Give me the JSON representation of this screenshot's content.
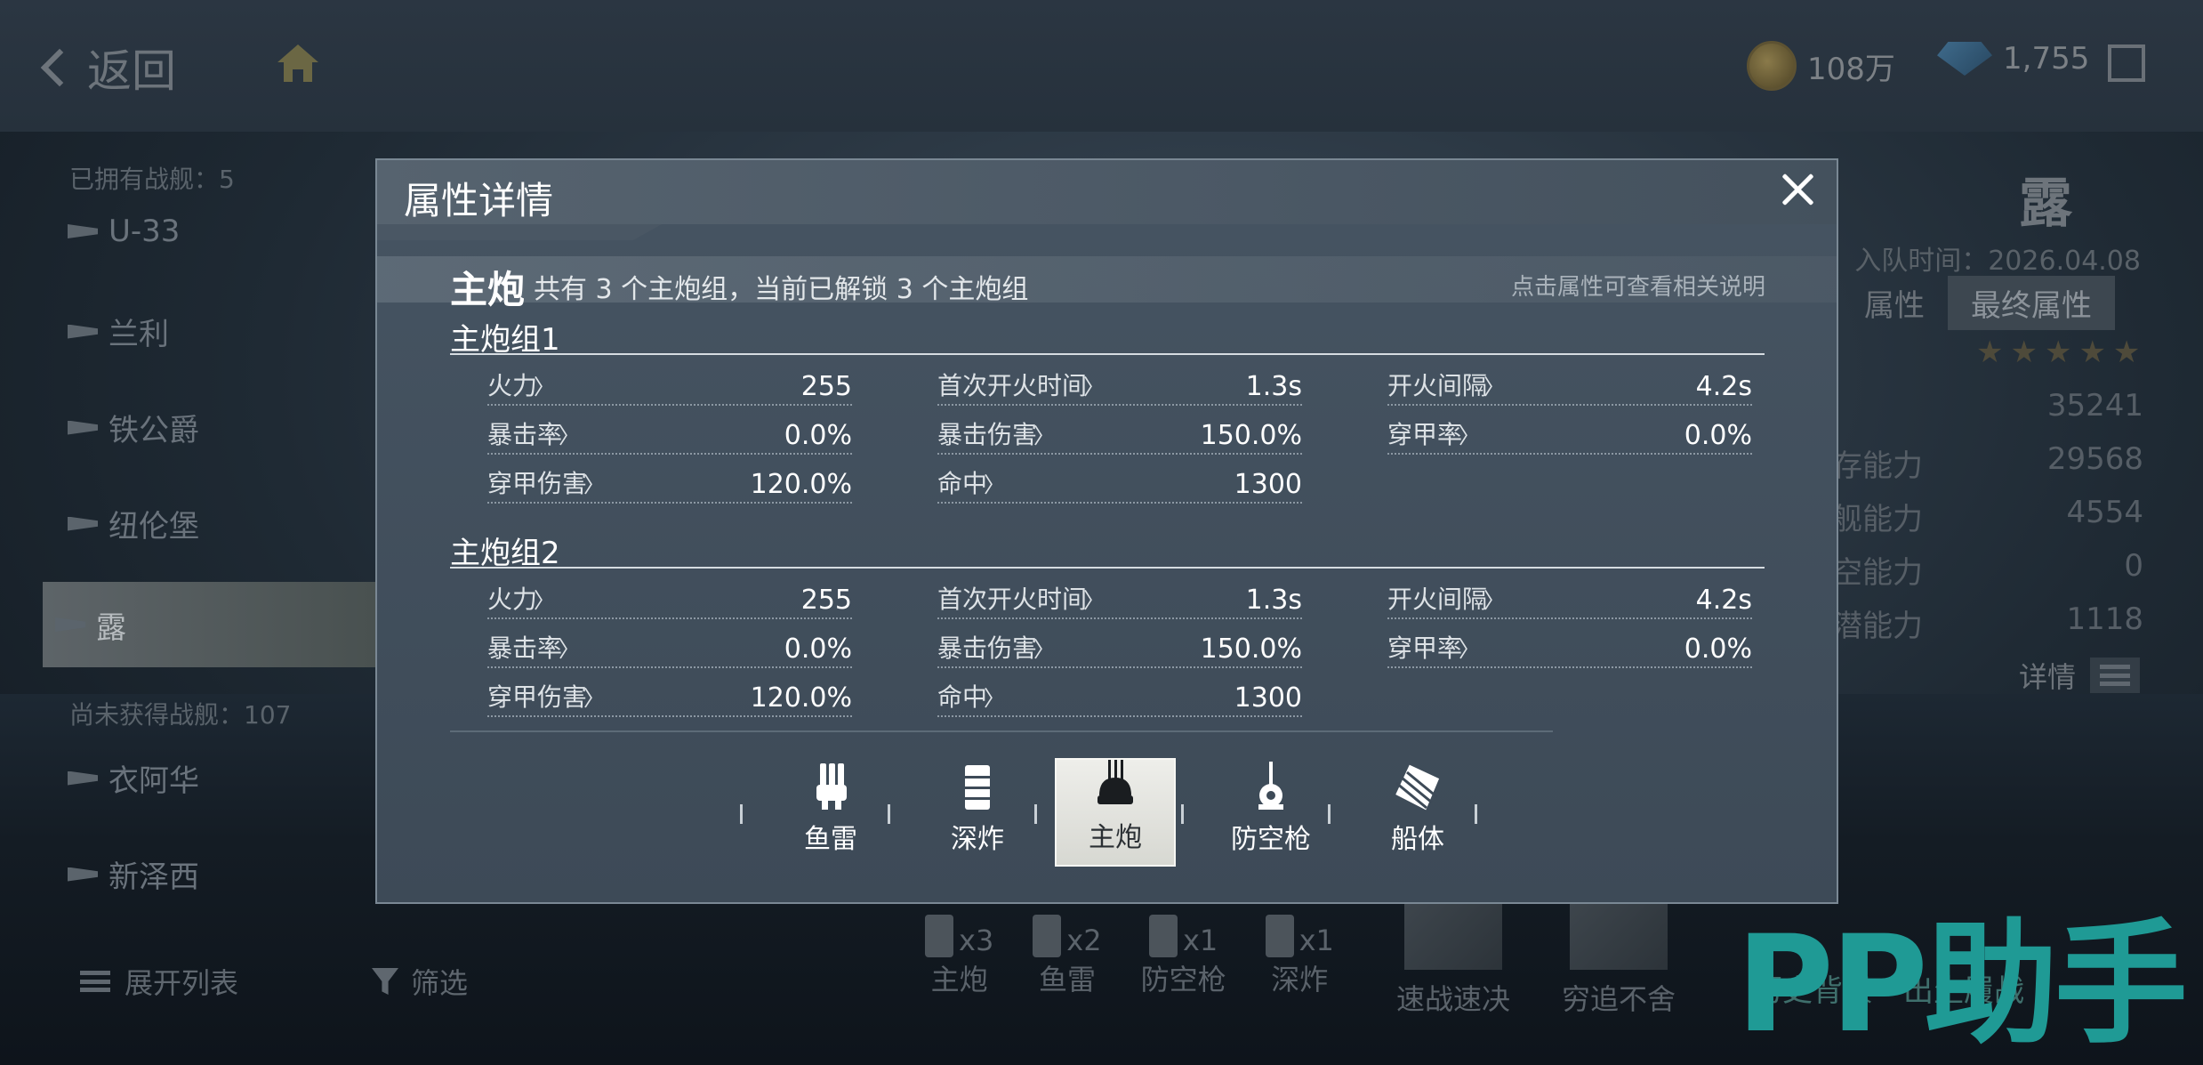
{
  "background": {
    "back_label": "返回",
    "currency": {
      "coins": "108万",
      "gems": "1,755"
    },
    "left_panel": {
      "owned_count": "已拥有战舰：5",
      "ships": [
        "U-33",
        "兰利",
        "铁公爵",
        "纽伦堡",
        "露"
      ],
      "selected_ship": "露",
      "unowned_count": "尚未获得战舰：107",
      "unowned_ships": [
        "衣阿华",
        "新泽西"
      ],
      "expand_list": "展开列表",
      "filter": "筛选"
    },
    "right_panel": {
      "ship_name": "露",
      "join_date": "入队时间：2026.04.08",
      "tabs": [
        "属性",
        "最终属性"
      ],
      "stars": "★★★★★",
      "stats": [
        {
          "label": "",
          "value": "35241"
        },
        {
          "label": "存能力",
          "value": "29568"
        },
        {
          "label": "舰能力",
          "value": "4554"
        },
        {
          "label": "空能力",
          "value": "0"
        },
        {
          "label": "潜能力",
          "value": "1118"
        }
      ],
      "details": "详情"
    },
    "equipment": [
      {
        "count": "x3",
        "label": "主炮"
      },
      {
        "count": "x2",
        "label": "鱼雷"
      },
      {
        "count": "x1",
        "label": "防空枪"
      },
      {
        "count": "x1",
        "label": "深炸"
      }
    ],
    "skills": [
      "速战速决",
      "穷追不舍"
    ],
    "bottom_links": [
      "历史背景",
      "出生履战"
    ],
    "watermark": "PP助手"
  },
  "modal": {
    "title": "属性详情",
    "section": {
      "name": "主炮",
      "description": "共有 3 个主炮组，当前已解锁 3 个主炮组",
      "hint": "点击属性可查看相关说明"
    },
    "groups": [
      {
        "title": "主炮组1",
        "stats": [
          {
            "name": "火力",
            "value": "255"
          },
          {
            "name": "首次开火时间",
            "value": "1.3s"
          },
          {
            "name": "开火间隔",
            "value": "4.2s"
          },
          {
            "name": "暴击率",
            "value": "0.0%"
          },
          {
            "name": "暴击伤害",
            "value": "150.0%"
          },
          {
            "name": "穿甲率",
            "value": "0.0%"
          },
          {
            "name": "穿甲伤害",
            "value": "120.0%"
          },
          {
            "name": "命中",
            "value": "1300"
          }
        ]
      },
      {
        "title": "主炮组2",
        "stats": [
          {
            "name": "火力",
            "value": "255"
          },
          {
            "name": "首次开火时间",
            "value": "1.3s"
          },
          {
            "name": "开火间隔",
            "value": "4.2s"
          },
          {
            "name": "暴击率",
            "value": "0.0%"
          },
          {
            "name": "暴击伤害",
            "value": "150.0%"
          },
          {
            "name": "穿甲率",
            "value": "0.0%"
          },
          {
            "name": "穿甲伤害",
            "value": "120.0%"
          },
          {
            "name": "命中",
            "value": "1300"
          }
        ]
      }
    ],
    "categories": [
      {
        "label": "鱼雷",
        "icon": "torpedo-icon"
      },
      {
        "label": "深炸",
        "icon": "depth-charge-icon"
      },
      {
        "label": "主炮",
        "icon": "main-gun-icon"
      },
      {
        "label": "防空枪",
        "icon": "anti-air-gun-icon"
      },
      {
        "label": "船体",
        "icon": "hull-icon"
      }
    ],
    "active_category": "主炮"
  },
  "colors": {
    "modal_bg": "#465462",
    "active_tab_bg": "#eeeeea",
    "watermark": "#1f9a95"
  }
}
